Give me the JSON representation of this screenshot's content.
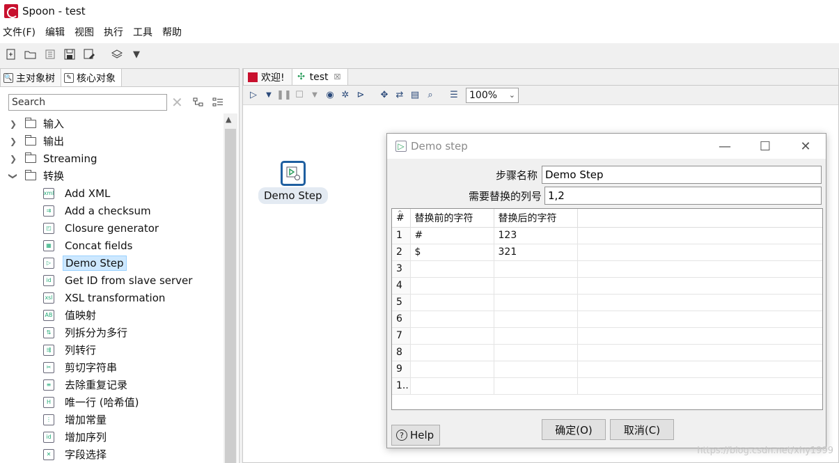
{
  "window": {
    "title": "Spoon - test"
  },
  "menu": [
    "文件(F)",
    "编辑",
    "视图",
    "执行",
    "工具",
    "帮助"
  ],
  "left_panel": {
    "tabs": [
      "主对象树",
      "核心对象"
    ],
    "search": {
      "placeholder": "Search",
      "value": "Search"
    },
    "folders": [
      "输入",
      "输出",
      "Streaming",
      "转换"
    ],
    "steps": [
      "Add XML",
      "Add a checksum",
      "Closure generator",
      "Concat fields",
      "Demo Step",
      "Get ID from slave server",
      "XSL transformation",
      "值映射",
      "列拆分为多行",
      "列转行",
      "剪切字符串",
      "去除重复记录",
      "唯一行 (哈希值)",
      "增加常量",
      "增加序列",
      "字段选择"
    ],
    "selected_step": "Demo Step"
  },
  "editor": {
    "tabs": [
      "欢迎!",
      "test"
    ],
    "zoom": "100%",
    "canvas_step": "Demo Step"
  },
  "dialog": {
    "title": "Demo step",
    "step_name_label": "步骤名称",
    "step_name_value": "Demo Step",
    "columns_label": "需要替换的列号",
    "columns_value": "1,2",
    "grid": {
      "headers": [
        "#",
        "替换前的字符",
        "替换后的字符"
      ],
      "rows": [
        [
          "1",
          "#",
          "123"
        ],
        [
          "2",
          "$",
          "321"
        ],
        [
          "3",
          "",
          ""
        ],
        [
          "4",
          "",
          ""
        ],
        [
          "5",
          "",
          ""
        ],
        [
          "6",
          "",
          ""
        ],
        [
          "7",
          "",
          ""
        ],
        [
          "8",
          "",
          ""
        ],
        [
          "9",
          "",
          ""
        ],
        [
          "1..",
          "",
          ""
        ]
      ]
    },
    "help_label": "Help",
    "ok_label": "确定(O)",
    "cancel_label": "取消(C)"
  },
  "watermark": "https://blog.csdn.net/xhy1999"
}
